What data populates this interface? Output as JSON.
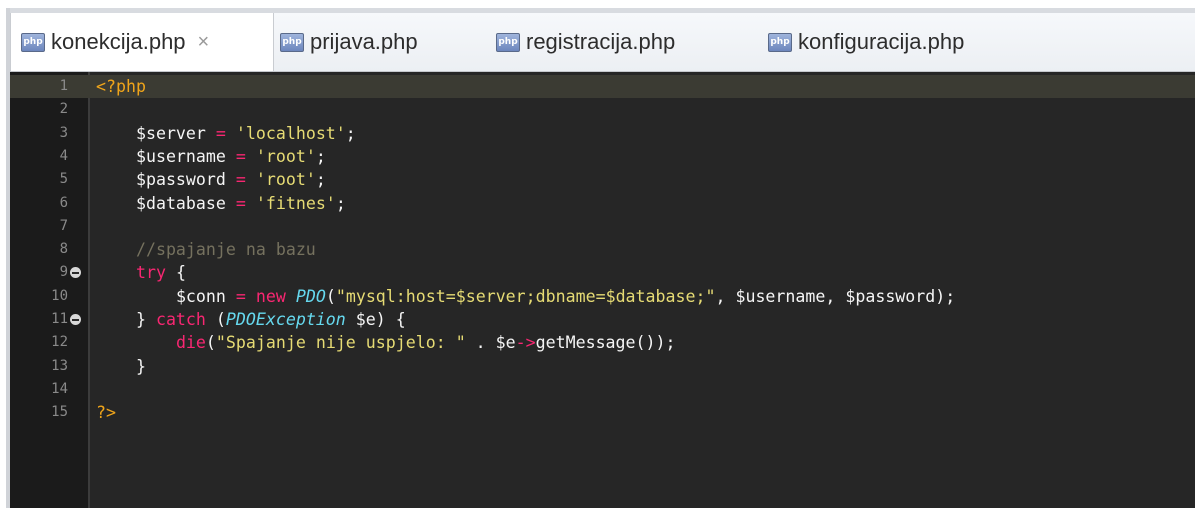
{
  "tabs": [
    {
      "label": "konekcija.php",
      "active": true,
      "close": "×"
    },
    {
      "label": "prijava.php",
      "active": false
    },
    {
      "label": "registracija.php",
      "active": false
    },
    {
      "label": "konfiguracija.php",
      "active": false
    }
  ],
  "tab_icon_text": "php",
  "line_numbers": [
    "1",
    "2",
    "3",
    "4",
    "5",
    "6",
    "7",
    "8",
    "9",
    "10",
    "11",
    "12",
    "13",
    "14",
    "15"
  ],
  "code": {
    "l1_open": "<?php",
    "l3_var": "$server",
    "l3_op": " = ",
    "l3_str": "'localhost'",
    "l3_end": ";",
    "l4_var": "$username",
    "l4_op": " = ",
    "l4_str": "'root'",
    "l4_end": ";",
    "l5_var": "$password",
    "l5_op": " = ",
    "l5_str": "'root'",
    "l5_end": ";",
    "l6_var": "$database",
    "l6_op": " = ",
    "l6_str": "'fitnes'",
    "l6_end": ";",
    "l8_comment": "//spajanje na bazu",
    "l9_kw": "try",
    "l9_rest": " {",
    "l10_var": "$conn",
    "l10_op": " = ",
    "l10_new": "new",
    "l10_cls": "PDO",
    "l10_p1": "(",
    "l10_str": "\"mysql:host=$server;dbname=$database;\"",
    "l10_rest": ", $username, $password);",
    "l11_a": "} ",
    "l11_kw": "catch",
    "l11_p": " (",
    "l11_cls": "PDOException",
    "l11_rest": " $e) {",
    "l12_kw": "die",
    "l12_p": "(",
    "l12_str": "\"Spajanje nije uspjelo: \"",
    "l12_mid": " . $e",
    "l12_op": "->",
    "l12_rest": "getMessage());",
    "l13": "}",
    "l15_close": "?>"
  },
  "colors": {
    "editor_bg": "#262626",
    "gutter_bg": "#1b1b1b",
    "string": "#e6db74",
    "keyword": "#f92672",
    "class": "#66d9ef",
    "comment": "#75715e",
    "php_tag": "#f0a51a"
  },
  "icons": {
    "tab": "php-file-icon",
    "close": "close-icon",
    "fold": "fold-collapse-icon"
  }
}
